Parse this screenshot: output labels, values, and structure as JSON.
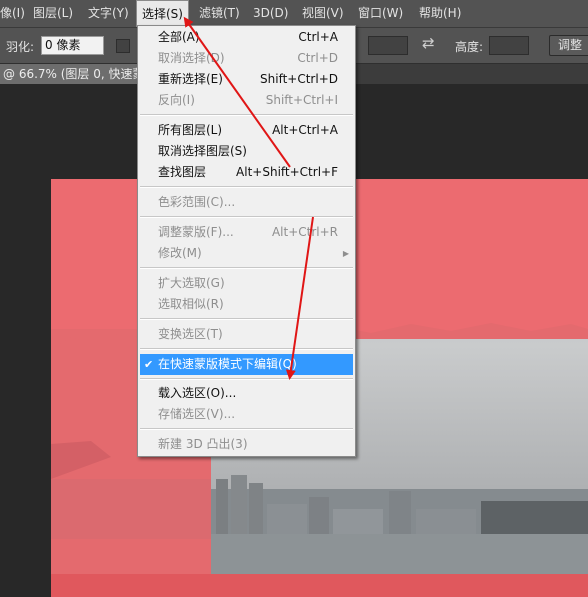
{
  "menubar": {
    "items": [
      "像(I)",
      "图层(L)",
      "文字(Y)",
      "选择(S)",
      "滤镜(T)",
      "3D(D)",
      "视图(V)",
      "窗口(W)",
      "帮助(H)"
    ]
  },
  "options": {
    "feather_label": "羽化:",
    "feather_value": "0 像素",
    "swap_icon": "swap-arrows-icon",
    "height_label": "高度:",
    "adjust_label": "调整"
  },
  "doc_tab": {
    "label": "@ 66.7% (图层 0, 快速蒙..."
  },
  "dropdown": {
    "items": [
      {
        "label": "全部(A)",
        "shortcut": "Ctrl+A",
        "enabled": true
      },
      {
        "label": "取消选择(D)",
        "shortcut": "Ctrl+D",
        "enabled": false
      },
      {
        "label": "重新选择(E)",
        "shortcut": "Shift+Ctrl+D",
        "enabled": true
      },
      {
        "label": "反向(I)",
        "shortcut": "Shift+Ctrl+I",
        "enabled": false
      },
      {
        "label": "所有图层(L)",
        "shortcut": "Alt+Ctrl+A",
        "enabled": true
      },
      {
        "label": "取消选择图层(S)",
        "shortcut": "",
        "enabled": true
      },
      {
        "label": "查找图层",
        "shortcut": "Alt+Shift+Ctrl+F",
        "enabled": true
      },
      {
        "label": "色彩范围(C)...",
        "shortcut": "",
        "enabled": false
      },
      {
        "label": "调整蒙版(F)...",
        "shortcut": "Alt+Ctrl+R",
        "enabled": false
      },
      {
        "label": "修改(M)",
        "shortcut": "",
        "enabled": false
      },
      {
        "label": "扩大选取(G)",
        "shortcut": "",
        "enabled": false
      },
      {
        "label": "选取相似(R)",
        "shortcut": "",
        "enabled": false
      },
      {
        "label": "变换选区(T)",
        "shortcut": "",
        "enabled": false
      },
      {
        "label": "在快速蒙版模式下编辑(Q)",
        "shortcut": "",
        "enabled": true,
        "checked": true
      },
      {
        "label": "载入选区(O)...",
        "shortcut": "",
        "enabled": true
      },
      {
        "label": "存储选区(V)...",
        "shortcut": "",
        "enabled": false
      },
      {
        "label": "新建 3D 凸出(3)",
        "shortcut": "",
        "enabled": false
      }
    ],
    "submenu_arrow": "chevron-right-icon",
    "check_icon": "checkmark-icon"
  },
  "annotation_color": "#e01616",
  "quickmask_color": "#ec6b70"
}
